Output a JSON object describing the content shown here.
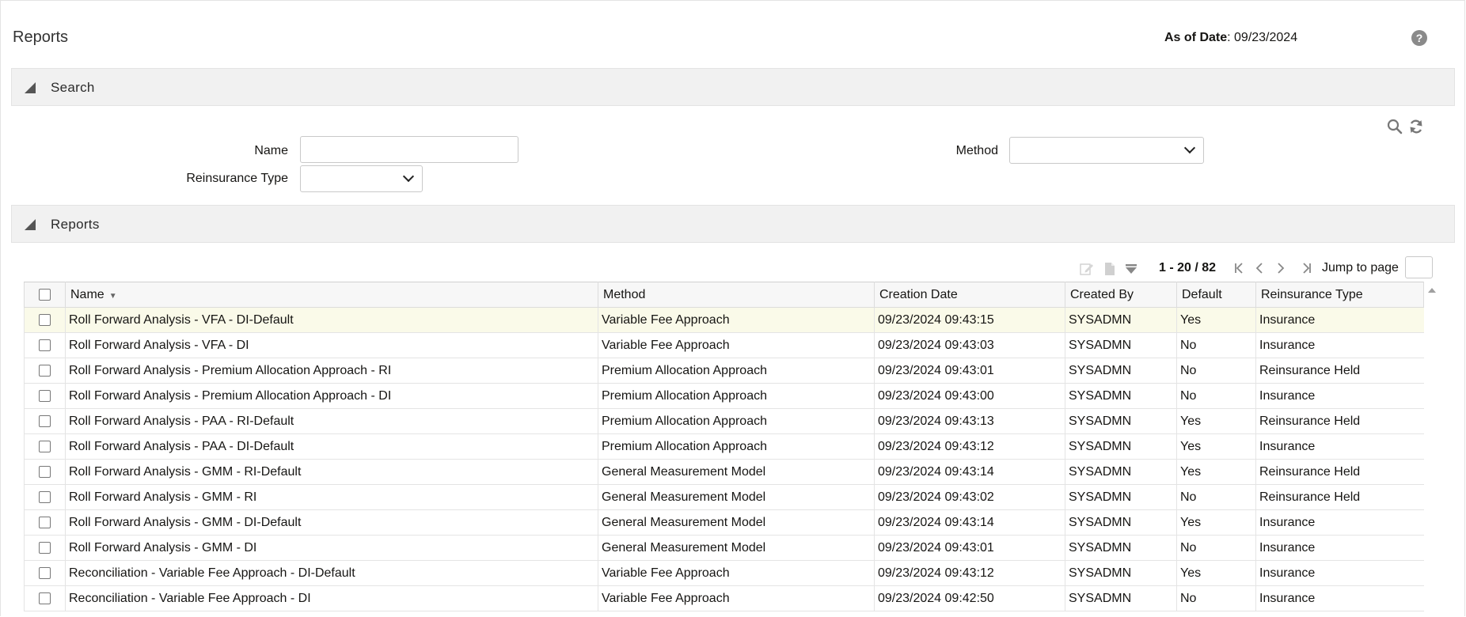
{
  "page": {
    "title": "Reports",
    "as_of_label": "As of Date",
    "as_of_value": ": 09/23/2024",
    "help_label": "?"
  },
  "search_panel": {
    "label": "Search",
    "name_label": "Name",
    "name_value": "",
    "reinsurance_label": "Reinsurance Type",
    "reinsurance_value": "",
    "method_label": "Method",
    "method_value": ""
  },
  "reports_panel": {
    "label": "Reports"
  },
  "pagination": {
    "range": "1 - 20 / 82",
    "jump_label": "Jump to page",
    "jump_value": ""
  },
  "table": {
    "columns": [
      "Name",
      "Method",
      "Creation Date",
      "Created By",
      "Default",
      "Reinsurance Type"
    ],
    "rows": [
      {
        "name": "Roll Forward Analysis - VFA - DI-Default",
        "method": "Variable Fee Approach",
        "date": "09/23/2024 09:43:15",
        "by": "SYSADMN",
        "default": "Yes",
        "type": "Insurance"
      },
      {
        "name": "Roll Forward Analysis - VFA - DI",
        "method": "Variable Fee Approach",
        "date": "09/23/2024 09:43:03",
        "by": "SYSADMN",
        "default": "No",
        "type": "Insurance"
      },
      {
        "name": "Roll Forward Analysis - Premium Allocation Approach - RI",
        "method": "Premium Allocation Approach",
        "date": "09/23/2024 09:43:01",
        "by": "SYSADMN",
        "default": "No",
        "type": "Reinsurance Held"
      },
      {
        "name": "Roll Forward Analysis - Premium Allocation Approach - DI",
        "method": "Premium Allocation Approach",
        "date": "09/23/2024 09:43:00",
        "by": "SYSADMN",
        "default": "No",
        "type": "Insurance"
      },
      {
        "name": "Roll Forward Analysis - PAA - RI-Default",
        "method": "Premium Allocation Approach",
        "date": "09/23/2024 09:43:13",
        "by": "SYSADMN",
        "default": "Yes",
        "type": "Reinsurance Held"
      },
      {
        "name": "Roll Forward Analysis - PAA - DI-Default",
        "method": "Premium Allocation Approach",
        "date": "09/23/2024 09:43:12",
        "by": "SYSADMN",
        "default": "Yes",
        "type": "Insurance"
      },
      {
        "name": "Roll Forward Analysis - GMM - RI-Default",
        "method": "General Measurement Model",
        "date": "09/23/2024 09:43:14",
        "by": "SYSADMN",
        "default": "Yes",
        "type": "Reinsurance Held"
      },
      {
        "name": "Roll Forward Analysis - GMM - RI",
        "method": "General Measurement Model",
        "date": "09/23/2024 09:43:02",
        "by": "SYSADMN",
        "default": "No",
        "type": "Reinsurance Held"
      },
      {
        "name": "Roll Forward Analysis - GMM - DI-Default",
        "method": "General Measurement Model",
        "date": "09/23/2024 09:43:14",
        "by": "SYSADMN",
        "default": "Yes",
        "type": "Insurance"
      },
      {
        "name": "Roll Forward Analysis - GMM - DI",
        "method": "General Measurement Model",
        "date": "09/23/2024 09:43:01",
        "by": "SYSADMN",
        "default": "No",
        "type": "Insurance"
      },
      {
        "name": "Reconciliation - Variable Fee Approach - DI-Default",
        "method": "Variable Fee Approach",
        "date": "09/23/2024 09:43:12",
        "by": "SYSADMN",
        "default": "Yes",
        "type": "Insurance"
      },
      {
        "name": "Reconciliation - Variable Fee Approach - DI",
        "method": "Variable Fee Approach",
        "date": "09/23/2024 09:42:50",
        "by": "SYSADMN",
        "default": "No",
        "type": "Insurance"
      }
    ]
  },
  "colors": {
    "selected_row": "#fafae9",
    "band_bg": "#f1f1f1",
    "header_bg": "#f7f7f7"
  },
  "icons": [
    "help-icon",
    "collapse-triangle-icon",
    "search-icon",
    "refresh-icon",
    "edit-icon",
    "add-icon",
    "filter-icon",
    "first-page-icon",
    "prev-page-icon",
    "next-page-icon",
    "last-page-icon",
    "sort-desc-icon",
    "scroll-up-icon"
  ]
}
